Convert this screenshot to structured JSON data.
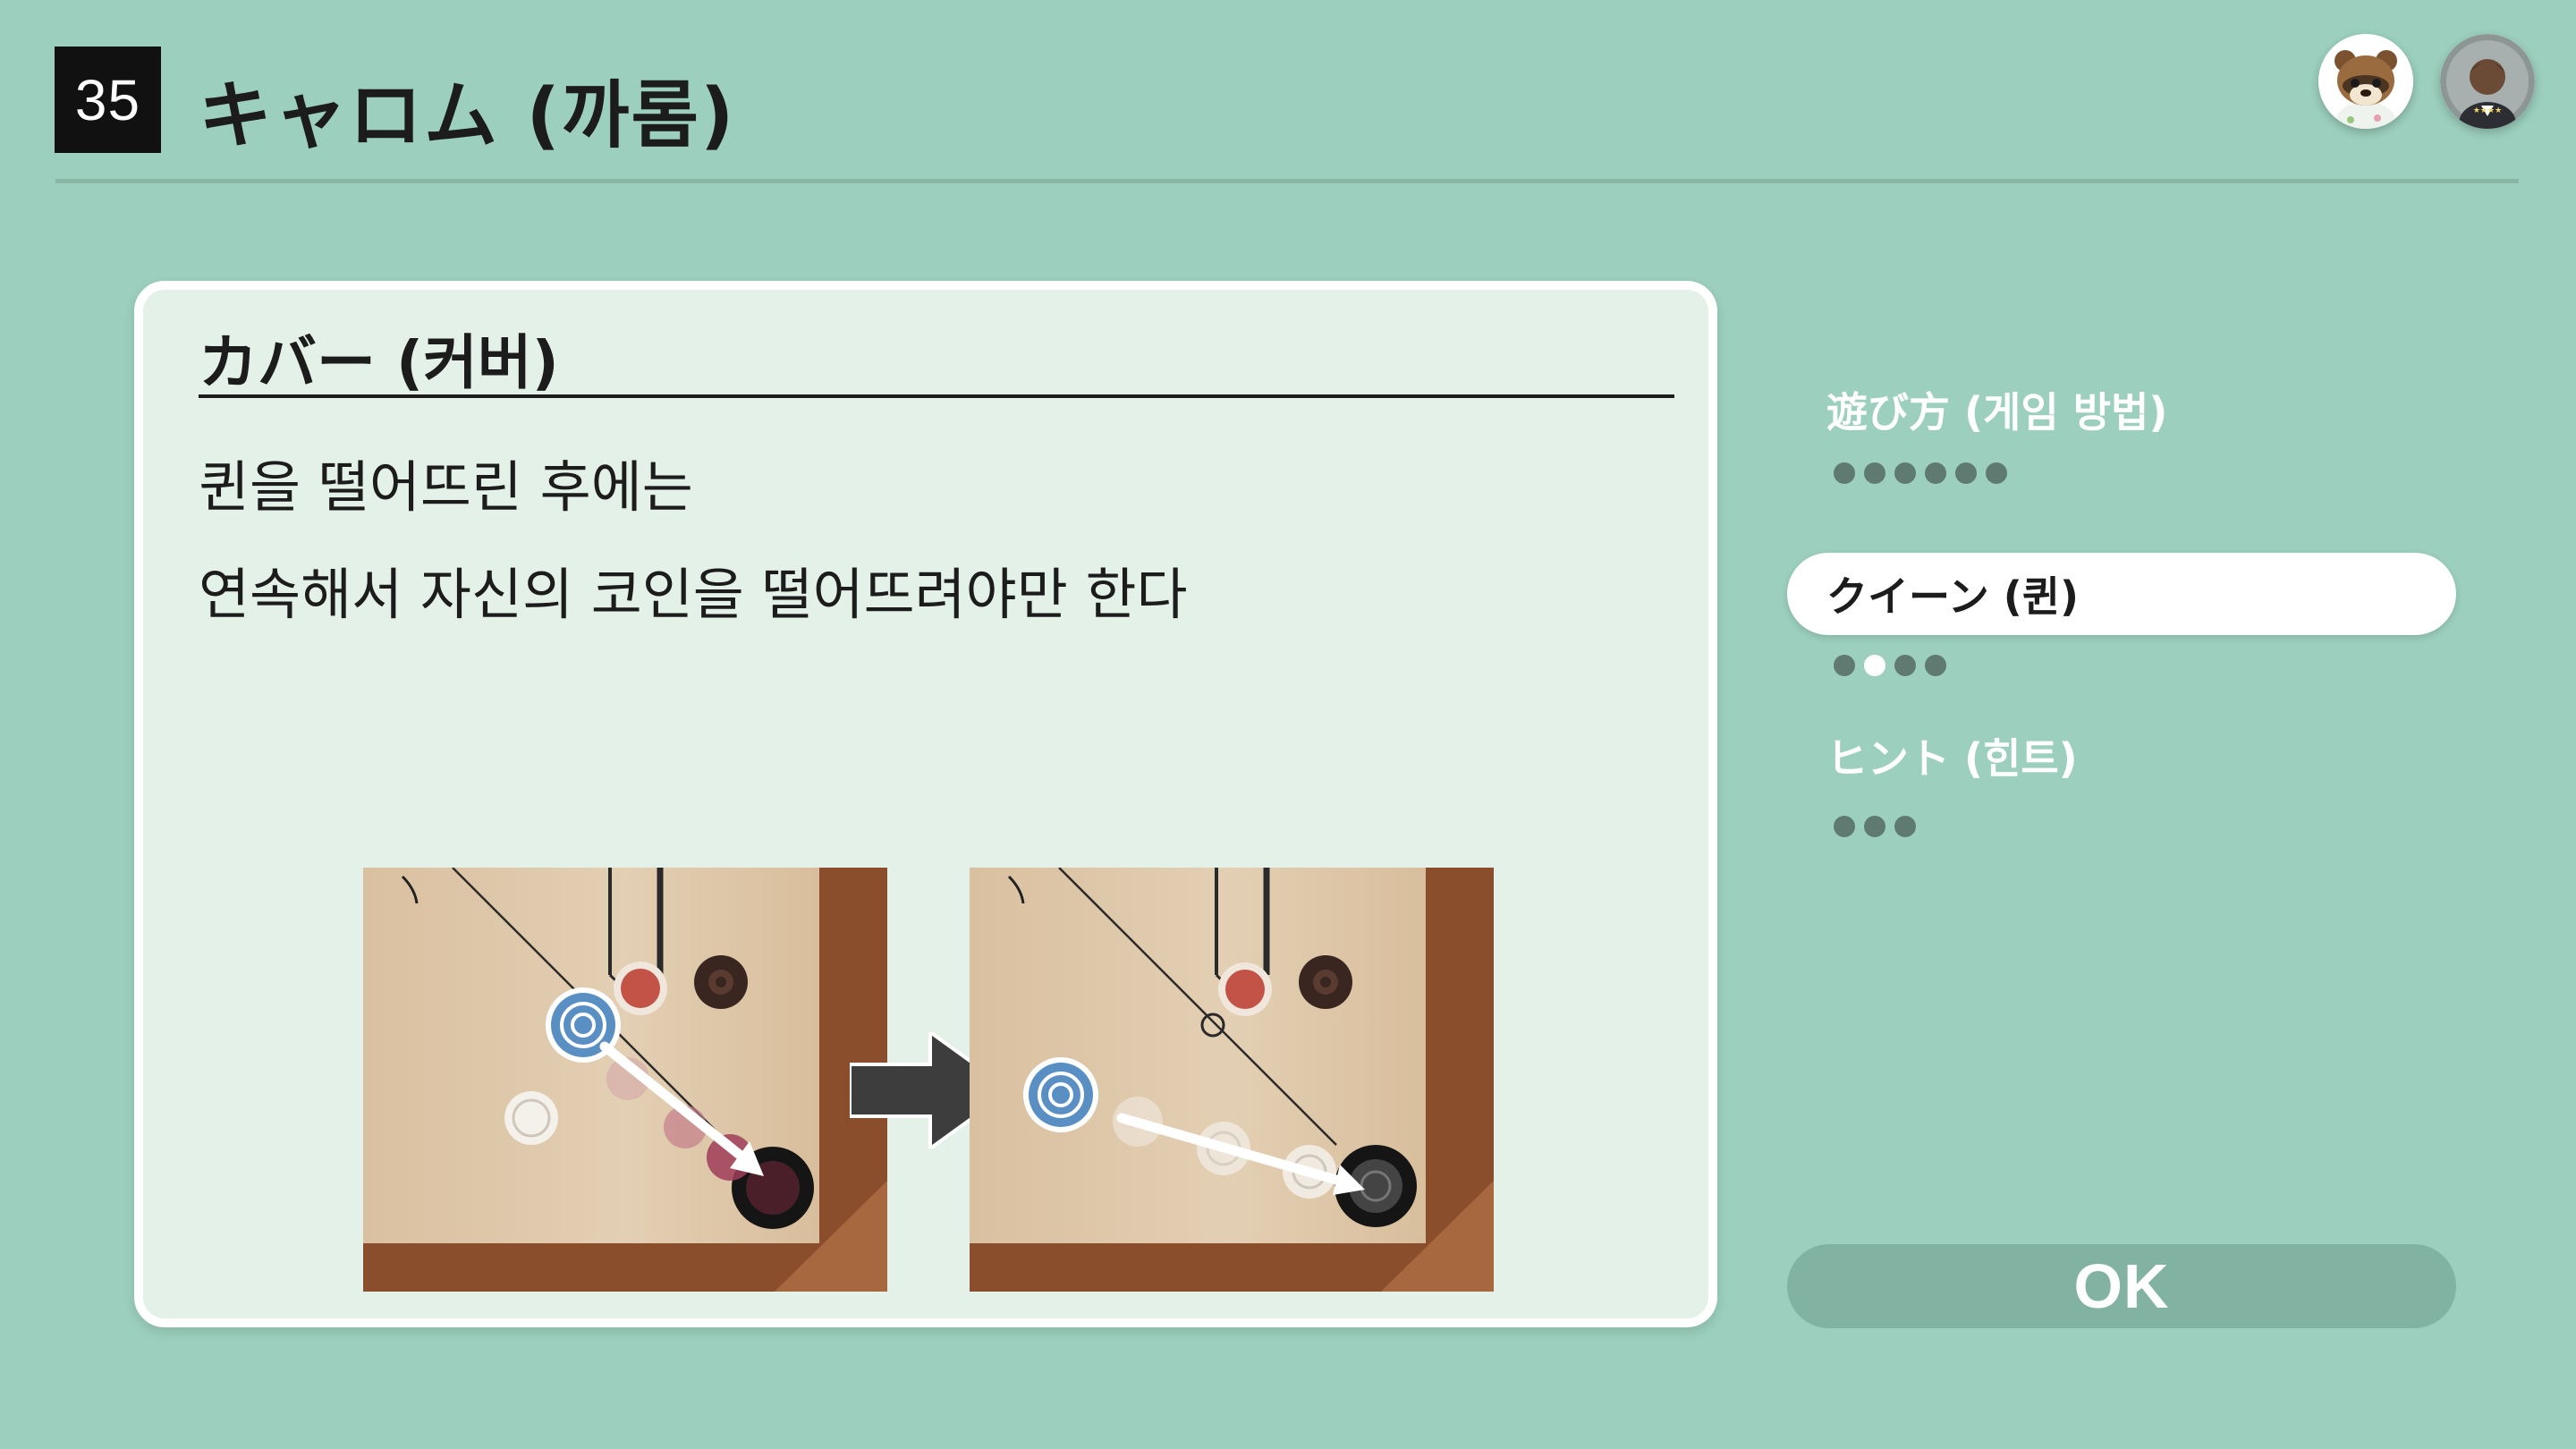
{
  "header": {
    "game_number": "35",
    "title": "キャロム (까롬)"
  },
  "panel": {
    "heading": "カバー (커버)",
    "lines": [
      "퀸을 떨어뜨린 후에는",
      "연속해서 자신의 코인을 떨어뜨려야만 한다"
    ]
  },
  "menu": {
    "items": [
      {
        "label": "遊び方 (게임 방법)",
        "pages": 6,
        "current_page": 0,
        "selected": false
      },
      {
        "label": "クイーン (퀸)",
        "pages": 4,
        "current_page": 2,
        "selected": true
      },
      {
        "label": "ヒント (힌트)",
        "pages": 3,
        "current_page": 0,
        "selected": false
      }
    ]
  },
  "ok_button": {
    "label": "OK"
  },
  "colors": {
    "background": "#9ccfbd",
    "panel_bg": "#e4f1e8",
    "selected_item_bg": "#ffffff",
    "ok_button_bg": "#82b3a2",
    "dot_inactive": "#5f7a71",
    "dot_active": "#ffffff"
  },
  "icons": {
    "avatar_1": "tom-nook-avatar-icon",
    "avatar_2": "player-avatar-icon",
    "arrow": "right-arrow-icon"
  }
}
